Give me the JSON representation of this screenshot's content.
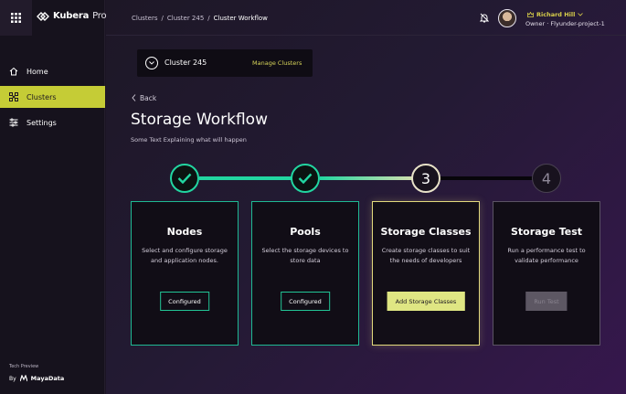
{
  "brand": {
    "name_bold": "Kubera",
    "name_light": "Propel"
  },
  "sidebar": {
    "items": [
      {
        "label": "Home",
        "icon": "home-icon"
      },
      {
        "label": "Clusters",
        "icon": "clusters-icon",
        "active": true
      },
      {
        "label": "Settings",
        "icon": "settings-icon"
      }
    ],
    "footer": {
      "tech_preview": "Tech Preview",
      "by": "By",
      "company": "MayaData"
    }
  },
  "breadcrumb": {
    "items": [
      "Clusters",
      "Cluster 245",
      "Cluster Workflow"
    ],
    "separator": "/"
  },
  "user": {
    "name": "Richard Hill",
    "role": "Owner · Flyunder-project-1"
  },
  "cluster_selector": {
    "name": "Cluster 245",
    "manage_label": "Manage Clusters"
  },
  "back_label": "Back",
  "page": {
    "title": "Storage Workflow",
    "subtitle": "Some Text Explaining what will happen"
  },
  "stepper": {
    "steps": [
      {
        "state": "done"
      },
      {
        "state": "done"
      },
      {
        "state": "current",
        "number": "3"
      },
      {
        "state": "todo",
        "number": "4"
      }
    ]
  },
  "cards": [
    {
      "title": "Nodes",
      "description": "Select and configure storage and application nodes.",
      "button": "Configured"
    },
    {
      "title": "Pools",
      "description": "Select the storage devices to store data",
      "button": "Configured"
    },
    {
      "title": "Storage Classes",
      "description": "Create storage classes to suit the needs of developers",
      "button": "Add Storage Classes"
    },
    {
      "title": "Storage Test",
      "description": "Run a performance test to validate performance",
      "button": "Run Test"
    }
  ],
  "colors": {
    "accent_teal": "#22d6a1",
    "accent_yellow": "#c5cc36",
    "background": "#1b1424"
  }
}
